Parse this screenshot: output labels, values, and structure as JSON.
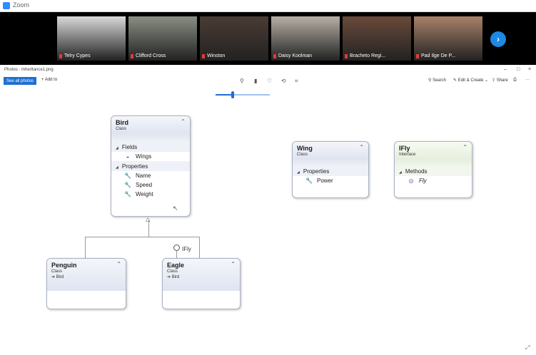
{
  "zoom": {
    "app_title": "Zoom",
    "participants": [
      {
        "name": "Telry Cypes",
        "bg": "#d9d9d9"
      },
      {
        "name": "Clifford Cross",
        "bg": "#8a8f83"
      },
      {
        "name": "Winston",
        "bg": "#4a3c35"
      },
      {
        "name": "Daisy Koolman",
        "bg": "#b7b0a5"
      },
      {
        "name": "Bracheto Regi...",
        "bg": "#6a4a3a"
      },
      {
        "name": "Pad Ilge De P...",
        "bg": "#a8826a"
      }
    ],
    "next_glyph": "›"
  },
  "photos": {
    "title": "Photos - Inheritance1.png",
    "window_controls": [
      "–",
      "□",
      "×"
    ],
    "toolbar": {
      "see_all": "See all photos",
      "add_to": "+ Add to",
      "icons": [
        "zoom-in-icon",
        "delete-icon",
        "favorite-icon",
        "rotate-icon",
        "crop-icon"
      ],
      "search": "Search",
      "edit_create": "Edit & Create",
      "share": "Share",
      "print_glyph": "⎙",
      "more_glyph": "···"
    }
  },
  "diagram": {
    "bird": {
      "name": "Bird",
      "type": "Class",
      "sections": [
        {
          "title": "Fields",
          "items": [
            "Wings"
          ]
        },
        {
          "title": "Properties",
          "items": [
            "Name",
            "Speed",
            "Weight"
          ]
        }
      ]
    },
    "wing": {
      "name": "Wing",
      "type": "Class",
      "sections": [
        {
          "title": "Properties",
          "items": [
            "Power"
          ]
        }
      ]
    },
    "ifly": {
      "name": "IFly",
      "type": "Interface",
      "sections": [
        {
          "title": "Methods",
          "items": [
            "Fly"
          ]
        }
      ]
    },
    "penguin": {
      "name": "Penguin",
      "type": "Class",
      "base": "Bird"
    },
    "eagle": {
      "name": "Eagle",
      "type": "Class",
      "base": "Bird",
      "implements": "IFly"
    }
  },
  "colors": {
    "accent": "#1f6fd1",
    "zoom_blue": "#2d8cff",
    "class_border": "#a9b2c3"
  }
}
